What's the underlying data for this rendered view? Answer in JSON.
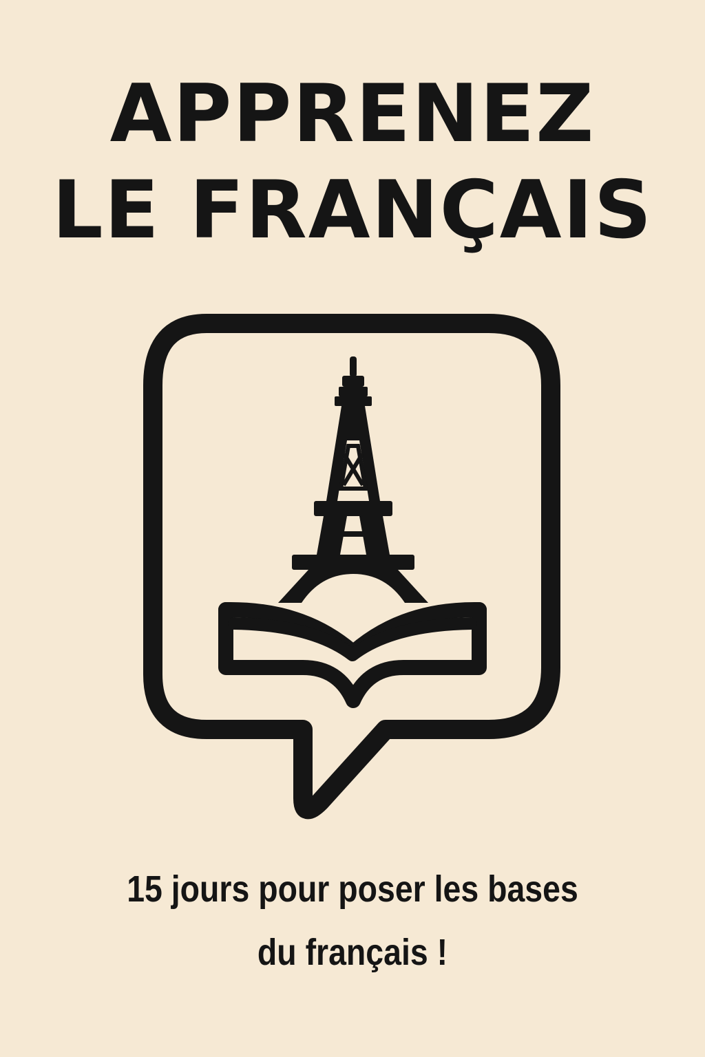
{
  "title": {
    "line1": "APPRENEZ",
    "line2": "LE FRANÇAIS"
  },
  "logo": {
    "frame_icon": "speech-bubble-icon",
    "tower_icon": "eiffel-tower-icon",
    "book_icon": "open-book-icon"
  },
  "subtitle": {
    "line1": "15 jours pour poser les bases",
    "line2": "du français !"
  },
  "colors": {
    "background": "#f6e9d4",
    "ink": "#151515"
  }
}
